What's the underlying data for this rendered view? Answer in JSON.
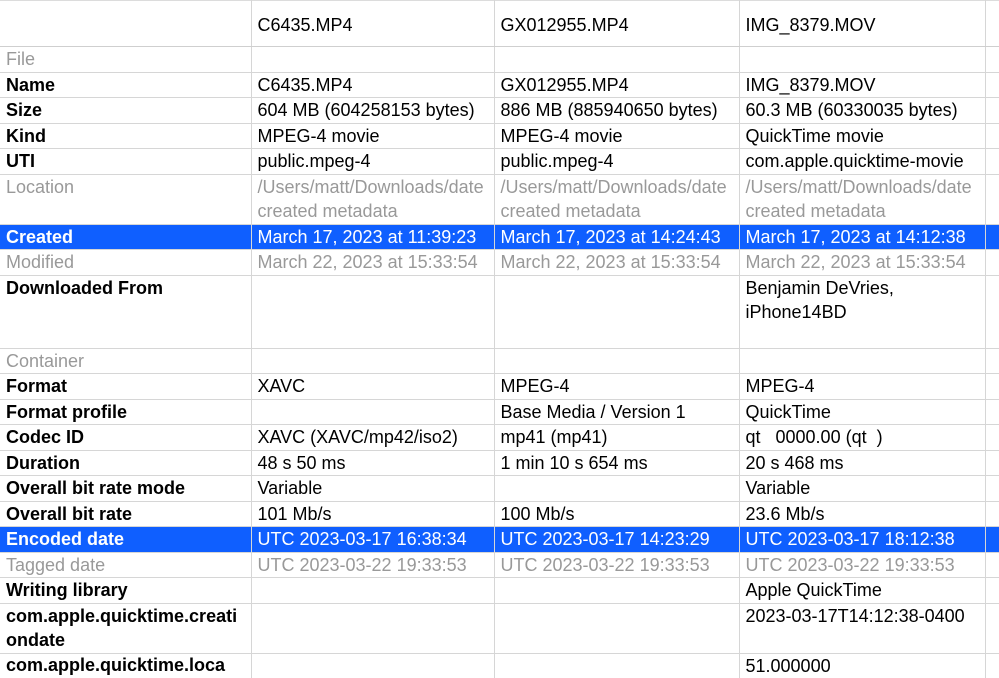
{
  "columns": [
    "C6435.MP4",
    "GX012955.MP4",
    "IMG_8379.MOV"
  ],
  "sections": {
    "file": {
      "label": "File"
    },
    "container": {
      "label": "Container"
    }
  },
  "rows": {
    "name": {
      "label": "Name",
      "c1": "C6435.MP4",
      "c2": "GX012955.MP4",
      "c3": "IMG_8379.MOV"
    },
    "size": {
      "label": "Size",
      "c1": "604 MB (604258153 bytes)",
      "c2": "886 MB (885940650 bytes)",
      "c3": "60.3 MB (60330035 bytes)"
    },
    "kind": {
      "label": "Kind",
      "c1": "MPEG-4 movie",
      "c2": "MPEG-4 movie",
      "c3": "QuickTime movie"
    },
    "uti": {
      "label": "UTI",
      "c1": "public.mpeg-4",
      "c2": "public.mpeg-4",
      "c3": "com.apple.quicktime-movie"
    },
    "location": {
      "label": "Location",
      "c1": "/Users/matt/Downloads/date created metadata",
      "c2": "/Users/matt/Downloads/date created metadata",
      "c3": "/Users/matt/Downloads/date created metadata"
    },
    "created": {
      "label": "Created",
      "c1": "March 17, 2023 at 11:39:23",
      "c2": "March 17, 2023 at 14:24:43",
      "c3": "March 17, 2023 at 14:12:38"
    },
    "modified": {
      "label": "Modified",
      "c1": "March 22, 2023 at 15:33:54",
      "c2": "March 22, 2023 at 15:33:54",
      "c3": "March 22, 2023 at 15:33:54"
    },
    "downloaded": {
      "label": "Downloaded From",
      "c1": "",
      "c2": "",
      "c3": "Benjamin DeVries, iPhone14BD"
    },
    "format": {
      "label": "Format",
      "c1": "XAVC",
      "c2": "MPEG-4",
      "c3": "MPEG-4"
    },
    "fprofile": {
      "label": "Format profile",
      "c1": "",
      "c2": "Base Media / Version 1",
      "c3": "QuickTime"
    },
    "codec": {
      "label": "Codec ID",
      "c1": "XAVC (XAVC/mp42/iso2)",
      "c2": "mp41 (mp41)",
      "c3": "qt   0000.00 (qt  )"
    },
    "duration": {
      "label": "Duration",
      "c1": "48 s 50 ms",
      "c2": "1 min 10 s 654 ms",
      "c3": "20 s 468 ms"
    },
    "brmode": {
      "label": "Overall bit rate mode",
      "c1": "Variable",
      "c2": "",
      "c3": "Variable"
    },
    "brate": {
      "label": "Overall bit rate",
      "c1": "101 Mb/s",
      "c2": "100 Mb/s",
      "c3": "23.6 Mb/s"
    },
    "encoded": {
      "label": "Encoded date",
      "c1": "UTC 2023-03-17 16:38:34",
      "c2": "UTC 2023-03-17 14:23:29",
      "c3": "UTC 2023-03-17 18:12:38"
    },
    "tagged": {
      "label": "Tagged date",
      "c1": "UTC 2023-03-22 19:33:53",
      "c2": "UTC 2023-03-22 19:33:53",
      "c3": "UTC 2023-03-22 19:33:53"
    },
    "wlib": {
      "label": "Writing library",
      "c1": "",
      "c2": "",
      "c3": "Apple QuickTime"
    },
    "qtdate": {
      "label": "com.apple.quicktime.creationdate",
      "c1": "",
      "c2": "",
      "c3": "2023-03-17T14:12:38-0400"
    },
    "qtloca": {
      "label": "com.apple.quicktime.loca",
      "c1": "",
      "c2": "",
      "c3": "51.000000"
    }
  }
}
